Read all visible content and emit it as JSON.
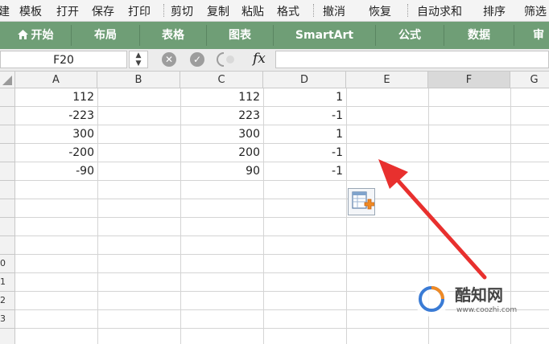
{
  "menu": {
    "items": [
      "建",
      "模板",
      "打开",
      "保存",
      "打印",
      "剪切",
      "复制",
      "粘贴",
      "格式",
      "撤消",
      "恢复",
      "自动求和",
      "排序",
      "筛选"
    ]
  },
  "ribbon": {
    "tabs": [
      "开始",
      "布局",
      "表格",
      "图表",
      "SmartArt",
      "公式",
      "数据",
      "审"
    ],
    "color": "#6f9e76"
  },
  "formula_bar": {
    "name_box": "F20",
    "fx_label": "fx",
    "content": ""
  },
  "columns": [
    "A",
    "B",
    "C",
    "D",
    "E",
    "F",
    "G"
  ],
  "selected_column": "F",
  "rows": [
    {
      "label": "",
      "A": "112",
      "B": "",
      "C": "112",
      "D": "1"
    },
    {
      "label": "",
      "A": "-223",
      "B": "",
      "C": "223",
      "D": "-1"
    },
    {
      "label": "",
      "A": "300",
      "B": "",
      "C": "300",
      "D": "1"
    },
    {
      "label": "",
      "A": "-200",
      "B": "",
      "C": "200",
      "D": "-1"
    },
    {
      "label": "",
      "A": "-90",
      "B": "",
      "C": "90",
      "D": "-1"
    },
    {
      "label": "",
      "A": "",
      "B": "",
      "C": "",
      "D": ""
    },
    {
      "label": "",
      "A": "",
      "B": "",
      "C": "",
      "D": ""
    },
    {
      "label": "",
      "A": "",
      "B": "",
      "C": "",
      "D": ""
    },
    {
      "label": "",
      "A": "",
      "B": "",
      "C": "",
      "D": ""
    },
    {
      "label": "0",
      "A": "",
      "B": "",
      "C": "",
      "D": ""
    },
    {
      "label": "1",
      "A": "",
      "B": "",
      "C": "",
      "D": ""
    },
    {
      "label": "2",
      "A": "",
      "B": "",
      "C": "",
      "D": ""
    },
    {
      "label": "3",
      "A": "",
      "B": "",
      "C": "",
      "D": ""
    },
    {
      "label": "",
      "A": "",
      "B": "",
      "C": "",
      "D": ""
    }
  ],
  "watermark": {
    "text": "酷知网",
    "url": "www.coozhi.com"
  },
  "annotation_color": "#e8302e"
}
